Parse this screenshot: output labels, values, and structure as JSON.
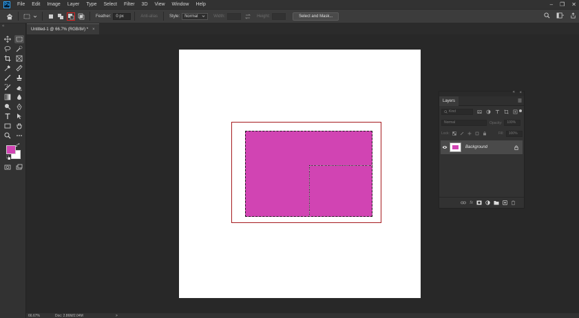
{
  "menu": {
    "logo": "Ps",
    "items": [
      "File",
      "Edit",
      "Image",
      "Layer",
      "Type",
      "Select",
      "Filter",
      "3D",
      "View",
      "Window",
      "Help"
    ]
  },
  "window_controls": {
    "minimize": "–",
    "restore": "❐",
    "close": "✕"
  },
  "options": {
    "feather_label": "Feather:",
    "feather_value": "0 px",
    "antialias_label": "Anti-alias",
    "style_label": "Style:",
    "style_value": "Normal",
    "width_label": "Width:",
    "height_label": "Height:",
    "select_mask_label": "Select and Mask..."
  },
  "document": {
    "tab_title": "Untitled-1 @ 66.7% (RGB/8#) *",
    "tab_close": "×"
  },
  "colors": {
    "foreground": "#d144b3",
    "background": "#ffffff",
    "shape": "#d144b3",
    "highlight": "#a4161a"
  },
  "layers_panel": {
    "tab_label": "Layers",
    "kind_placeholder": "Kind",
    "blend_mode": "Normal",
    "opacity_label": "Opacity:",
    "opacity_value": "100%",
    "lock_label": "Lock:",
    "fill_label": "Fill:",
    "fill_value": "100%",
    "layers": [
      {
        "name": "Background",
        "locked": true,
        "visible": true
      }
    ]
  },
  "status": {
    "zoom": "66.67%",
    "doc_size": "Doc: 2.86M/2.04M",
    "arrow": ">"
  }
}
